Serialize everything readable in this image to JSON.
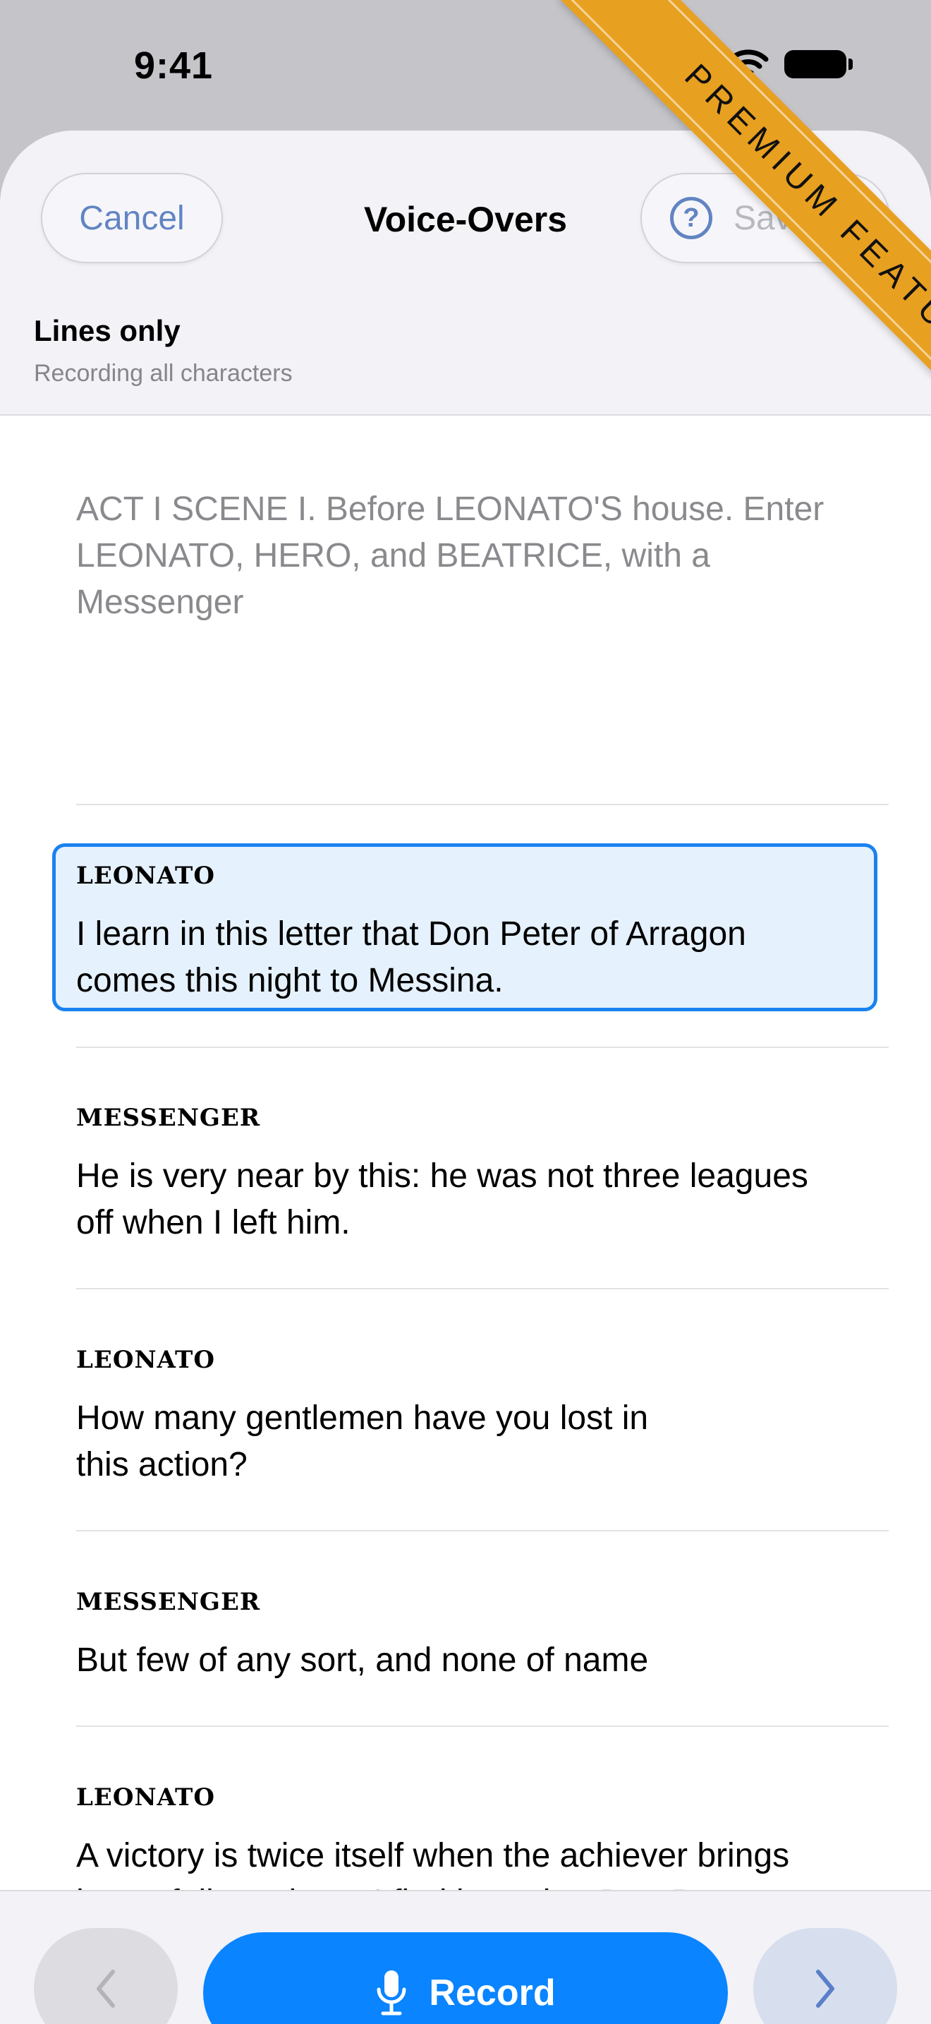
{
  "status_bar": {
    "time": "9:41"
  },
  "nav": {
    "cancel_label": "Cancel",
    "title": "Voice-Overs",
    "help_glyph": "?",
    "save_label": "Save"
  },
  "mode": {
    "title": "Lines only",
    "subtitle": "Recording all characters"
  },
  "script": {
    "stage_direction": "ACT I SCENE I. Before LEONATO'S house. Enter LEONATO, HERO, and BEATRICE, with a Messenger",
    "lines": [
      {
        "character": "LEONATO",
        "text_1": "I learn in this letter that Don Peter of Arragon",
        "text_2": "comes this night to Messina.",
        "selected": true
      },
      {
        "character": "MESSENGER",
        "text_1": "He is very near by this: he was not three leagues",
        "text_2": "off when I left him."
      },
      {
        "character": "LEONATO",
        "text_1": "How many gentlemen have you lost in",
        "text_2": "this action?"
      },
      {
        "character": "MESSENGER",
        "text_1": "But few of any sort, and none of name",
        "text_2": ""
      },
      {
        "character": "LEONATO",
        "text_1": "A victory is twice itself when the achiever brings",
        "text_2": "home full numbers. I find here that Don Peter"
      }
    ]
  },
  "toolbar": {
    "record_label": "Record",
    "prev_icon": "chevron-left-icon",
    "next_icon": "chevron-right-icon",
    "mic_icon": "microphone-icon"
  },
  "ribbon": {
    "label": "PREMIUM FEATURE"
  },
  "colors": {
    "accent": "#0a84ff",
    "selected_fill": "#e5f1fd",
    "ribbon": "#e8a020",
    "link": "#6284c2"
  }
}
